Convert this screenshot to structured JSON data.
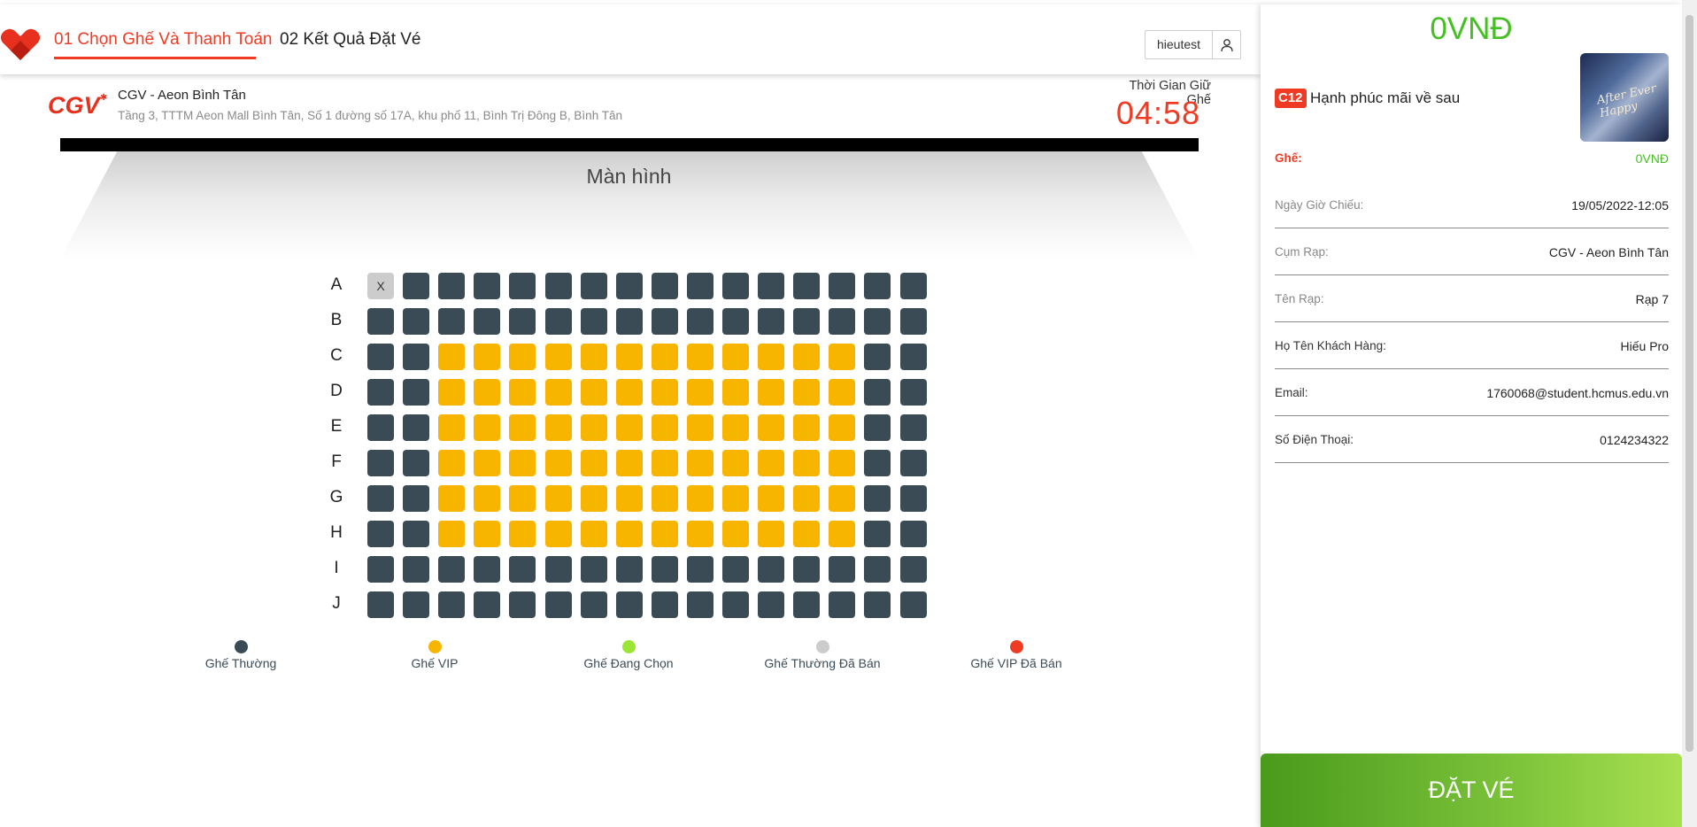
{
  "nav": {
    "step1": "01 Chọn Ghế Và Thanh Toán",
    "step2": "02 Kết Quả Đặt Vé",
    "username": "hieutest",
    "logo_icon": "heart-logo-icon",
    "user_icon": "user-icon"
  },
  "cinema": {
    "logo_text": "CGV",
    "name": "CGV - Aeon Bình Tân",
    "address": "Tầng 3, TTTM Aeon Mall Bình Tân, Số 1 đường số 17A, khu phố 11, Bình Trị Đông B, Bình Tân"
  },
  "timer": {
    "label": "Thời Gian Giữ Ghế",
    "value": "04:58"
  },
  "screen": {
    "label": "Màn hình"
  },
  "seats": {
    "rows": [
      "A",
      "B",
      "C",
      "D",
      "E",
      "F",
      "G",
      "H",
      "I",
      "J"
    ],
    "seats_per_row": 16,
    "booked_mark": "X",
    "booked": [
      {
        "row": "A",
        "index": 0
      }
    ],
    "vip_rows": [
      "C",
      "D",
      "E",
      "F",
      "G",
      "H"
    ],
    "vip_columns": [
      2,
      3,
      4,
      5,
      6,
      7,
      8,
      9,
      10,
      11,
      12,
      13
    ]
  },
  "legend": [
    {
      "label": "Ghế Thường",
      "color": "#3b4b56"
    },
    {
      "label": "Ghế VIP",
      "color": "#f8b500"
    },
    {
      "label": "Ghế Đang Chọn",
      "color": "#9be534"
    },
    {
      "label": "Ghế Thường Đã Bán",
      "color": "#cccccc"
    },
    {
      "label": "Ghế VIP Đã Bán",
      "color": "#ef3b24"
    }
  ],
  "summary": {
    "total": "0VNĐ",
    "rating": "C12",
    "movie_title": "Hạnh phúc mãi về sau",
    "poster_text": "After Ever Happy",
    "seat_label": "Ghế:",
    "seat_value": "0VNĐ",
    "showtime_label": "Ngày Giờ Chiếu:",
    "showtime_value": "19/05/2022-12:05",
    "cluster_label": "Cụm Rạp:",
    "cluster_value": "CGV - Aeon Bình Tân",
    "theater_label": "Tên Rạp:",
    "theater_value": "Rạp 7",
    "customer_label": "Họ Tên Khách Hàng:",
    "customer_value": "Hiếu Pro",
    "email_label": "Email:",
    "email_value": "1760068@student.hcmus.edu.vn",
    "phone_label": "Số Điện Thoại:",
    "phone_value": "0124234322",
    "book_button": "ĐẶT VÉ"
  },
  "colors": {
    "accent": "#ef3b24",
    "green": "#44c020",
    "seat": "#3b4b56",
    "vip": "#f8b500"
  }
}
